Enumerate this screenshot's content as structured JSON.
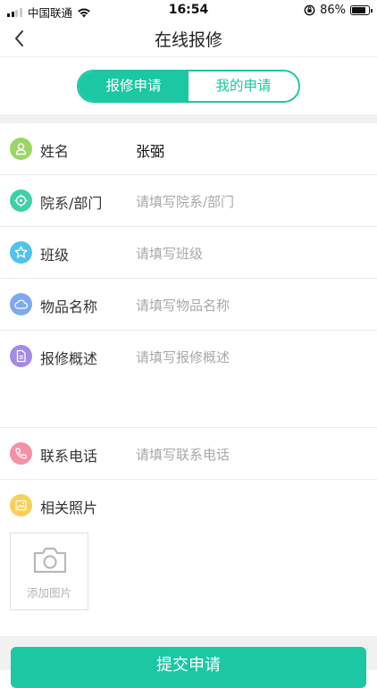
{
  "status_bar": {
    "carrier": "中国联通",
    "time": "16:54",
    "battery": "86%",
    "battery_level": 0.86
  },
  "nav": {
    "title": "在线报修",
    "back_icon": "chevron-left-icon"
  },
  "tabs": [
    {
      "label": "报修申请",
      "active": true
    },
    {
      "label": "我的申请",
      "active": false
    }
  ],
  "form": {
    "name": {
      "label": "姓名",
      "value": "张弼",
      "icon": "user-icon",
      "color": "#9ad665"
    },
    "department": {
      "label": "院系/部门",
      "placeholder": "请填写院系/部门",
      "icon": "crosshair-icon",
      "color": "#3ed1a6"
    },
    "class": {
      "label": "班级",
      "placeholder": "请填写班级",
      "icon": "star-icon",
      "color": "#4fc3f0"
    },
    "item_name": {
      "label": "物品名称",
      "placeholder": "请填写物品名称",
      "icon": "cloud-icon",
      "color": "#7ea8f2"
    },
    "description": {
      "label": "报修概述",
      "placeholder": "请填写报修概述",
      "icon": "document-icon",
      "color": "#a58ae6"
    },
    "phone": {
      "label": "联系电话",
      "placeholder": "请填写联系电话",
      "icon": "phone-icon",
      "color": "#f590a6"
    },
    "photos": {
      "label": "相关照片",
      "icon": "image-icon",
      "color": "#f9cf57",
      "add_label": "添加图片"
    }
  },
  "submit_label": "提交申请",
  "accent_color": "#1bc8a3"
}
